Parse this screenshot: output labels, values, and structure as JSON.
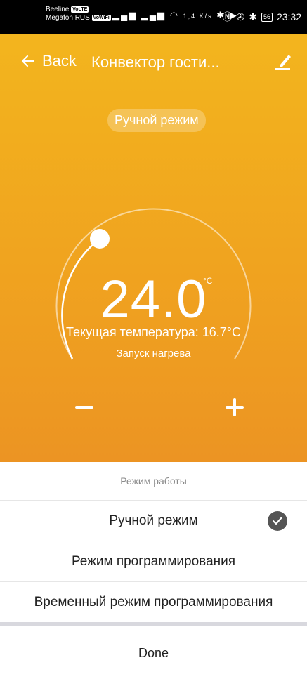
{
  "status_bar": {
    "carrier1": "Beeline",
    "carrier1_tag": "VoLTE",
    "carrier2": "Megafon RUS",
    "carrier2_tag": "VoWiFi",
    "network_speed": "1,4 K/s",
    "battery": "56",
    "time": "23:32"
  },
  "header": {
    "back_label": "Back",
    "title": "Конвектор гости..."
  },
  "mode_pill": "Ручной режим",
  "thermostat": {
    "set_temperature": "24.0",
    "unit": "°C",
    "current_temperature_label": "Текущая температура: 16.7°C",
    "status": "Запуск нагрева"
  },
  "sheet": {
    "title": "Режим работы",
    "options": [
      {
        "label": "Ручной режим",
        "selected": true
      },
      {
        "label": "Режим программирования",
        "selected": false
      },
      {
        "label": "Временный режим программирования",
        "selected": false
      }
    ],
    "done_label": "Done"
  },
  "colors": {
    "accent_top": "#f3b51e",
    "accent_bottom": "#ec9423",
    "check": "#555555"
  }
}
